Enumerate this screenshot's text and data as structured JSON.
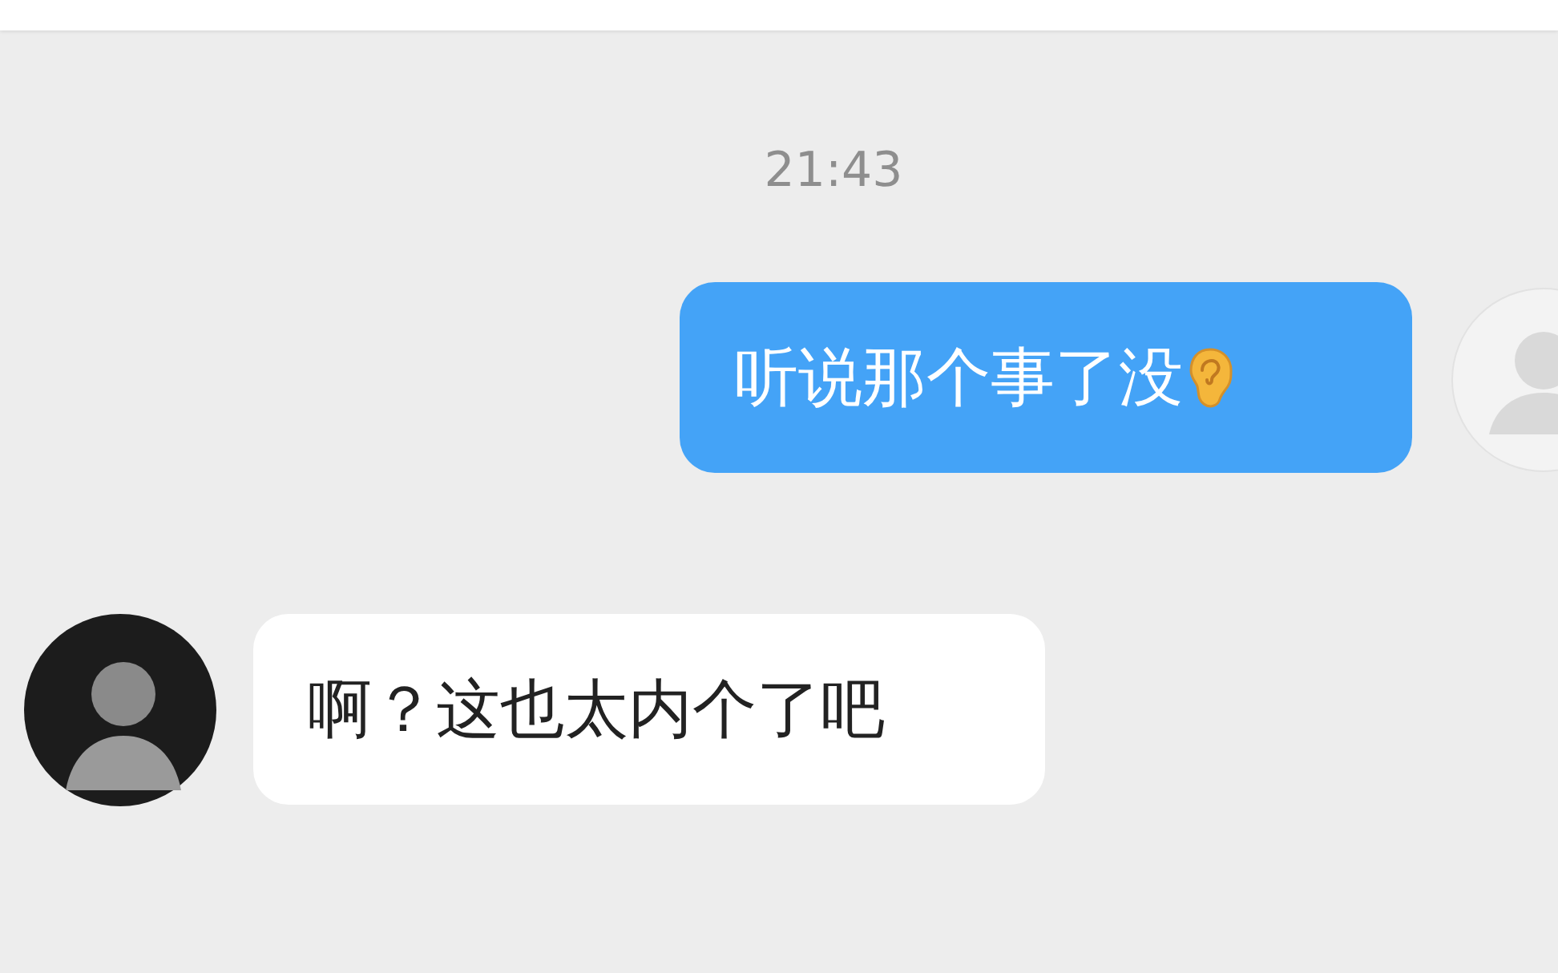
{
  "time": "21:43",
  "messages": [
    {
      "kind": "outgoing",
      "text": "听说那个事了没"
    },
    {
      "kind": "incoming",
      "text": "啊？这也太内个了吧"
    }
  ]
}
